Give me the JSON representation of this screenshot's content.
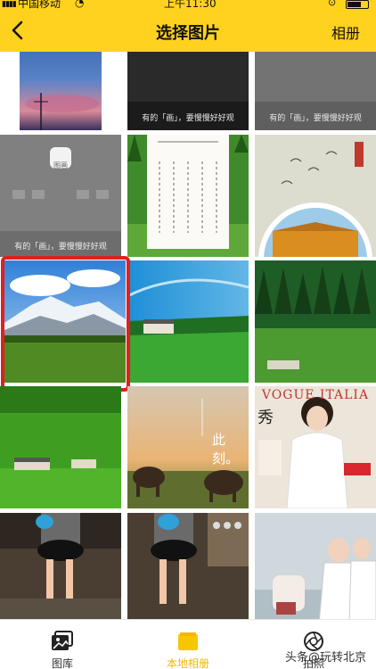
{
  "status_bar": {
    "carrier": "中国移动",
    "time": "上午11:30"
  },
  "nav": {
    "title": "选择图片",
    "album_button": "相册"
  },
  "grid": {
    "photos": [
      {
        "caption": ""
      },
      {
        "caption": "有的「画」，要慢慢好好观"
      },
      {
        "caption": "有的「画」，要慢慢好好观"
      },
      {
        "caption": "有的「画」，要慢慢好好观",
        "badge": "图画"
      },
      {
        "caption": ""
      },
      {
        "caption": ""
      },
      {
        "caption": "",
        "selected": true
      },
      {
        "caption": ""
      },
      {
        "caption": ""
      },
      {
        "caption": ""
      },
      {
        "caption": "此刻。"
      },
      {
        "caption": "秀",
        "badge": "VOGUE ITALIA"
      },
      {
        "caption": ""
      },
      {
        "caption": ""
      },
      {
        "caption": ""
      }
    ]
  },
  "tabbar": {
    "tabs": [
      {
        "label": "图库"
      },
      {
        "label": "本地相册",
        "active": true
      },
      {
        "label": "拍照"
      }
    ]
  },
  "watermark": "头条@玩转北京",
  "colors": {
    "accent": "#ffd21f",
    "selected_border": "#e02020",
    "active_tab": "#f2b705"
  }
}
